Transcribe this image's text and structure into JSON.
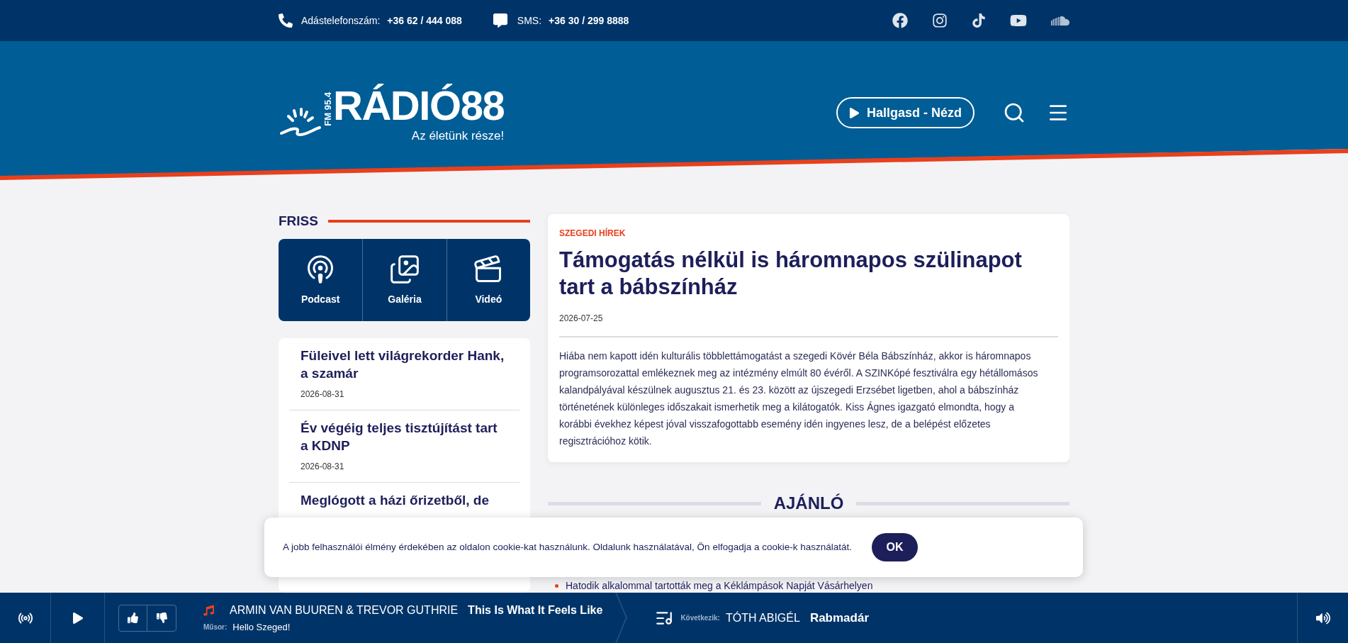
{
  "top_bar": {
    "phone": {
      "label": "Adástelefonszám:",
      "number": "+36 62 / 444 088"
    },
    "sms": {
      "label": "SMS:",
      "number": "+36 30 / 299 8888"
    },
    "socials": [
      {
        "kind": "facebook"
      },
      {
        "kind": "instagram"
      },
      {
        "kind": "tiktok"
      },
      {
        "kind": "youtube"
      },
      {
        "kind": "soundcloud"
      }
    ]
  },
  "header": {
    "logo": {
      "frequency": "FM 95.4",
      "name": "RÁDIÓ88",
      "tagline": "Az életünk része!"
    },
    "listen_button": "Hallgasd - Nézd"
  },
  "friss": {
    "title": "FRISS",
    "tiles": [
      {
        "kind": "podcast",
        "label": "Podcast"
      },
      {
        "kind": "gallery",
        "label": "Galéria"
      },
      {
        "kind": "video",
        "label": "Videó"
      }
    ],
    "news": [
      {
        "title": "Füleivel lett világrekorder Hank, a szamár",
        "date": "2026-08-31"
      },
      {
        "title": "Év végéig teljes tisztújítást tart a KDNP",
        "date": "2026-08-31"
      },
      {
        "title": "Meglógott a házi őrizetből, de"
      }
    ]
  },
  "article": {
    "category": "SZEGEDI HÍREK",
    "title": "Támogatás nélkül is háromnapos szülinapot tart a bábszínház",
    "date": "2026-07-25",
    "body": "Hiába nem kapott idén kulturális többlettámogatást a szegedi Kövér Béla Bábszínház, akkor is háromnapos programsorozattal emlékeznek meg az intézmény elmúlt 80 évéről. A SZINKópé fesztiválra egy hétállomásos kalandpályával készülnek augusztus 21. és 23. között az újszegedi Erzsébet ligetben, ahol a bábszínház történetének különleges időszakait ismerhetik meg a kilátogatók. Kiss Ágnes igazgató elmondta, hogy a korábbi évekhez képest jóval visszafogottabb esemény idén ingyenes lesz, de a belépést előzetes regisztrációhoz kötik."
  },
  "ajanlo": {
    "title": "AJÁNLÓ",
    "items": [
      "Hatodik alkalommal tartották meg a Kéklámpások Napját Vásárhelyen"
    ]
  },
  "cookie": {
    "text": "A jobb felhasználói élmény érdekében az oldalon cookie-kat használunk. Oldalunk használatával, Ön elfogadja a cookie-k használatát.",
    "button": "OK"
  },
  "player": {
    "artist": "ARMIN VAN BUUREN & TREVOR GUTHRIE",
    "title": "This Is What It Feels Like",
    "show_label": "Műsor:",
    "show": "Hello Szeged!",
    "next_label": "Következik:",
    "next_artist": "TÓTH ABIGÉL",
    "next_title": "Rabmadár"
  }
}
